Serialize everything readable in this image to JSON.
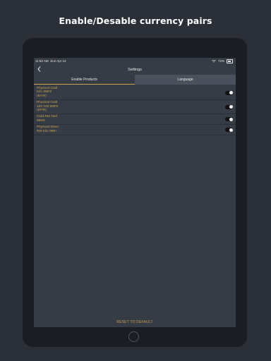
{
  "headline": "Enable/Desable currency pairs",
  "status_bar": {
    "time": "11:52 AM",
    "date": "Sun Apr 14",
    "battery": "72%",
    "wifi_icon": "wifi-icon",
    "battery_icon": "battery-icon"
  },
  "nav": {
    "title": "Settings",
    "back_icon": "chevron-left-icon"
  },
  "tabs": [
    {
      "label": "Enable Products",
      "active": true
    },
    {
      "label": "Language",
      "active": false
    }
  ],
  "products": [
    {
      "label": "Physical Gold\nKilo 999'9\n(MYR)",
      "enabled": true
    },
    {
      "label": "Physical Gold\n100 GM 999'9\n(MYR)",
      "enabled": true
    },
    {
      "label": "Gold RM Tael\n999'9",
      "enabled": true
    },
    {
      "label": "Physical Silver\nRM Kilo 999+",
      "enabled": true
    }
  ],
  "reset_label": "RESET TO DEFAULT",
  "colors": {
    "accent": "#c9a24a",
    "screen_bg": "#363c45",
    "tab_bg": "#4a515c",
    "page_bg": "#2b3038"
  }
}
